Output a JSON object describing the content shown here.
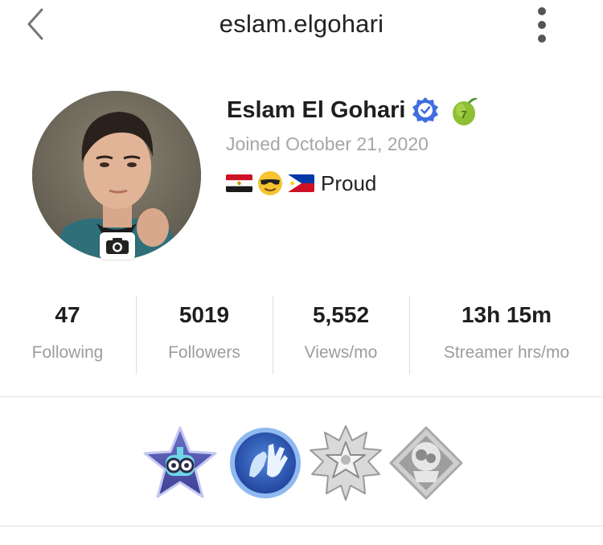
{
  "header": {
    "username": "eslam.elgohari",
    "back_icon": "chevron-left-icon",
    "more_icon": "vertical-dots-icon"
  },
  "profile": {
    "display_name": "Eslam El Gohari",
    "verified": true,
    "level": "7",
    "joined": "Joined October 21, 2020",
    "bio_icons": [
      "egypt-flag-icon",
      "sunglasses-emoji-icon",
      "philippines-flag-icon"
    ],
    "bio_text": "Proud"
  },
  "stats": [
    {
      "value": "47",
      "label": "Following"
    },
    {
      "value": "5019",
      "label": "Followers"
    },
    {
      "value": "5,552",
      "label": "Views/mo"
    },
    {
      "value": "13h 15m",
      "label": "Streamer hrs/mo"
    }
  ],
  "badges": [
    {
      "name": "star-robot-badge-icon"
    },
    {
      "name": "high-five-badge-icon"
    },
    {
      "name": "silver-star-medal-badge-icon"
    },
    {
      "name": "grey-diamond-badge-icon"
    }
  ],
  "colors": {
    "verified_blue": "#3f6fe0",
    "secondary_text": "#a6a6a6",
    "divider": "#e3e3e3"
  }
}
